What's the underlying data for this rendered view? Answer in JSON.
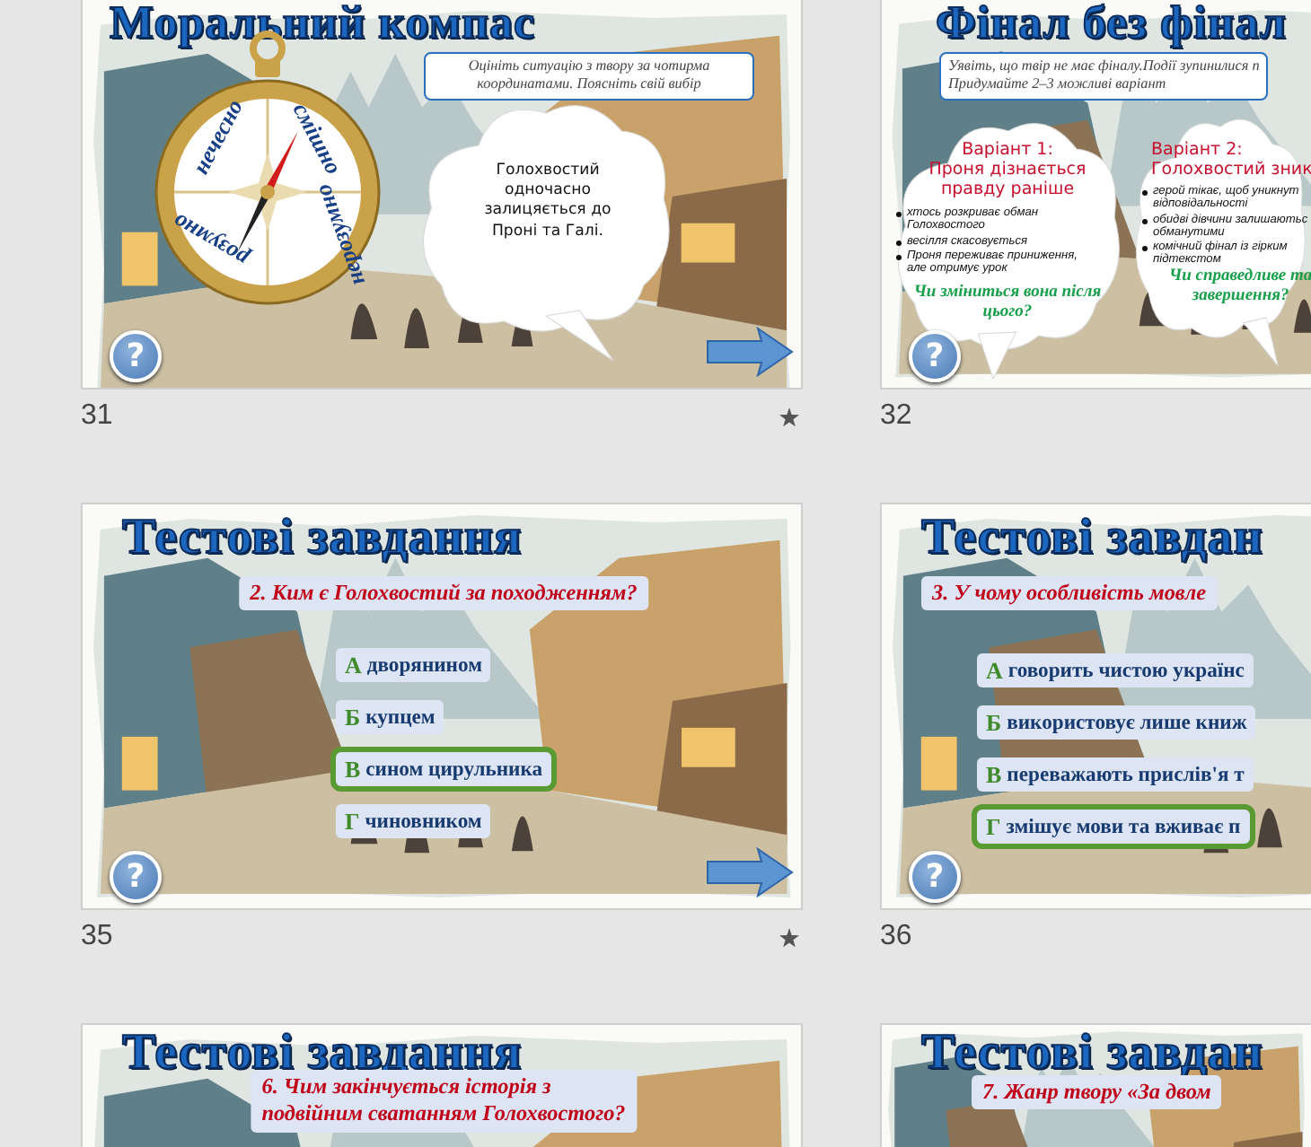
{
  "slides": [
    {
      "number": "31",
      "starred": true,
      "kind": "compass",
      "title": "Моральний компас",
      "instruction": "Оцініть ситуацію з твору за чотирма координатами. Поясніть свій вибір",
      "compass_labels": [
        "нечесно",
        "смішно",
        "нерозумно",
        "розумно"
      ],
      "bubble": "Голохвостий одночасно залицяється до Проні та Галі.",
      "help": "?"
    },
    {
      "number": "32",
      "kind": "variants",
      "title": "Фінал без фінал",
      "instruction": [
        "Уявіть, що твір не має фіналу.Події зупинилися п",
        "Придумайте  2–3 можливі варіант"
      ],
      "variants": [
        {
          "heading": [
            "Варіант 1:",
            "Проня дізнається",
            "правду раніше"
          ],
          "bullets": [
            [
              "хтось розкриває обман",
              "Голохвостого"
            ],
            [
              "весілля скасовується"
            ],
            [
              "Проня переживає приниження,",
              "але отримує урок"
            ]
          ],
          "question": [
            "Чи зміниться вона після",
            "цього?"
          ]
        },
        {
          "heading": [
            "Варіант 2:",
            "Голохвостий зник"
          ],
          "bullets": [
            [
              "герой тікає, щоб уникнут",
              "відповідальності"
            ],
            [
              "обидві дівчини залишаютьс",
              "обманутими"
            ],
            [
              "комічний фінал із гірким",
              "підтекстом"
            ]
          ],
          "question": [
            "Чи справедливе та",
            "завершення?"
          ]
        }
      ],
      "help": "?"
    },
    {
      "number": "35",
      "starred": true,
      "kind": "test",
      "title": "Тестові завдання",
      "question": [
        "2. Ким є Голохвостий за походженням?"
      ],
      "options": [
        {
          "letter": "А",
          "text": "дворянином",
          "selected": false
        },
        {
          "letter": "Б",
          "text": "купцем",
          "selected": false
        },
        {
          "letter": "В",
          "text": "сином цирульника",
          "selected": true
        },
        {
          "letter": "Г",
          "text": "чиновником",
          "selected": false
        }
      ],
      "help": "?"
    },
    {
      "number": "36",
      "kind": "test",
      "title": "Тестові завдан",
      "question": [
        "3. У чому особливість мовле"
      ],
      "options": [
        {
          "letter": "А",
          "text": "говорить чистою українс",
          "selected": false
        },
        {
          "letter": "Б",
          "text": "використовує лише книж",
          "selected": false
        },
        {
          "letter": "В",
          "text": "переважають прислів'я т",
          "selected": false
        },
        {
          "letter": "Г",
          "text": "змішує мови та вживає п",
          "selected": true
        }
      ],
      "help": "?"
    },
    {
      "kind": "test",
      "title": "Тестові завдання",
      "question": [
        "6. Чим закінчується історія з",
        "подвійним сватанням Голохвостого?"
      ]
    },
    {
      "kind": "test",
      "title": "Тестові завдан",
      "question": [
        "7. Жанр твору «За двом"
      ]
    }
  ]
}
